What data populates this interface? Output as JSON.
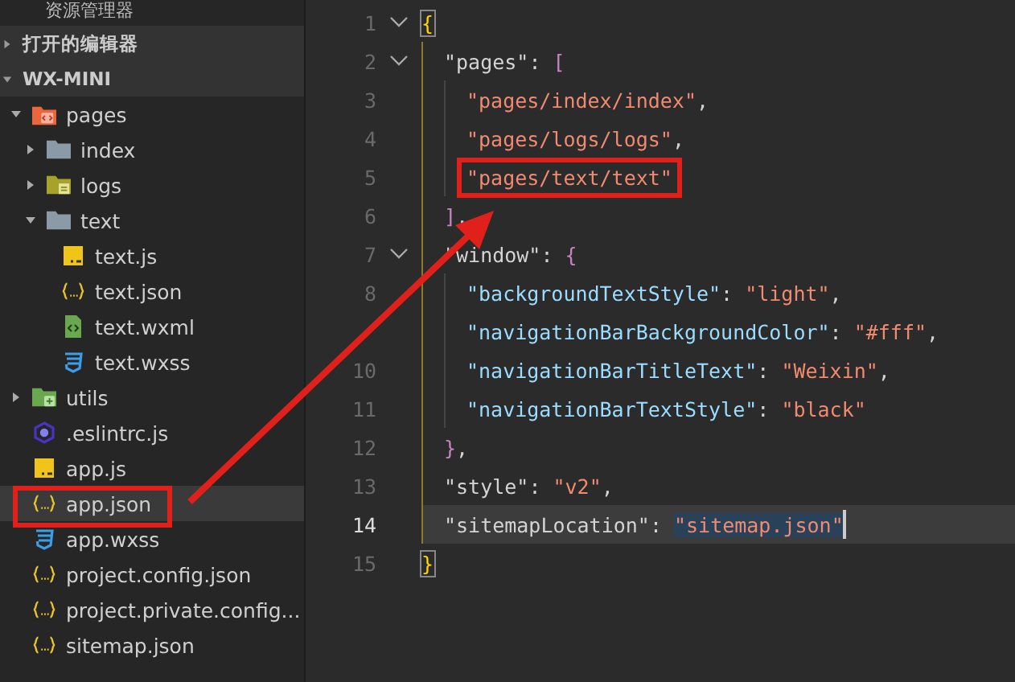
{
  "sidebar": {
    "title": "资源管理器",
    "sections": [
      {
        "label": "打开的编辑器",
        "expanded": false
      },
      {
        "label": "WX-MINI",
        "expanded": true
      }
    ],
    "tree": [
      {
        "label": "pages",
        "kind": "folder-pages",
        "expanded": true,
        "selected": false,
        "boxed": false,
        "children": [
          {
            "label": "index",
            "kind": "folder",
            "expanded": false,
            "selected": false,
            "boxed": false
          },
          {
            "label": "logs",
            "kind": "folder-logs",
            "expanded": false,
            "selected": false,
            "boxed": false
          },
          {
            "label": "text",
            "kind": "folder",
            "expanded": true,
            "selected": false,
            "boxed": false,
            "children": [
              {
                "label": "text.js",
                "kind": "js",
                "selected": false,
                "boxed": false
              },
              {
                "label": "text.json",
                "kind": "json",
                "selected": false,
                "boxed": false
              },
              {
                "label": "text.wxml",
                "kind": "wxml",
                "selected": false,
                "boxed": false
              },
              {
                "label": "text.wxss",
                "kind": "wxss",
                "selected": false,
                "boxed": false
              }
            ]
          }
        ]
      },
      {
        "label": "utils",
        "kind": "folder-utils",
        "expanded": false,
        "selected": false,
        "boxed": false
      },
      {
        "label": ".eslintrc.js",
        "kind": "eslint",
        "selected": false,
        "boxed": false
      },
      {
        "label": "app.js",
        "kind": "js",
        "selected": false,
        "boxed": false
      },
      {
        "label": "app.json",
        "kind": "json",
        "selected": true,
        "boxed": true
      },
      {
        "label": "app.wxss",
        "kind": "wxss",
        "selected": false,
        "boxed": false
      },
      {
        "label": "project.config.json",
        "kind": "json",
        "selected": false,
        "boxed": false
      },
      {
        "label": "project.private.config...",
        "kind": "json",
        "selected": false,
        "boxed": false
      },
      {
        "label": "sitemap.json",
        "kind": "json",
        "selected": false,
        "boxed": false
      }
    ]
  },
  "editor": {
    "lines": [
      {
        "number": "1",
        "foldable": true,
        "current": false,
        "boxed": false,
        "tokens": [
          {
            "kind": "brace-matched",
            "text": "{"
          }
        ],
        "children": [
          {
            "number": "2",
            "foldable": true,
            "current": false,
            "boxed": false,
            "tokens": [
              {
                "kind": "property",
                "text": "\"pages\""
              },
              {
                "kind": "punct",
                "text": ": "
              },
              {
                "kind": "bracket",
                "text": "["
              }
            ],
            "children": [
              {
                "number": "3",
                "foldable": false,
                "current": false,
                "boxed": false,
                "tokens": [
                  {
                    "kind": "string",
                    "text": "\"pages/index/index\""
                  },
                  {
                    "kind": "punct",
                    "text": ","
                  }
                ]
              },
              {
                "number": "4",
                "foldable": false,
                "current": false,
                "boxed": false,
                "tokens": [
                  {
                    "kind": "string",
                    "text": "\"pages/logs/logs\""
                  },
                  {
                    "kind": "punct",
                    "text": ","
                  }
                ]
              },
              {
                "number": "5",
                "foldable": false,
                "current": false,
                "boxed": true,
                "tokens": [
                  {
                    "kind": "string",
                    "text": "\"pages/text/text\""
                  }
                ]
              }
            ]
          },
          {
            "number": "6",
            "foldable": false,
            "current": false,
            "boxed": false,
            "tokens": [
              {
                "kind": "bracket",
                "text": "]"
              },
              {
                "kind": "punct",
                "text": ","
              }
            ]
          },
          {
            "number": "7",
            "foldable": true,
            "current": false,
            "boxed": false,
            "tokens": [
              {
                "kind": "property",
                "text": "\"window\""
              },
              {
                "kind": "punct",
                "text": ": "
              },
              {
                "kind": "bracket",
                "text": "{"
              }
            ],
            "children": [
              {
                "number": "8",
                "foldable": false,
                "current": false,
                "boxed": false,
                "tokens": [
                  {
                    "kind": "nested-property",
                    "text": "\"backgroundTextStyle\""
                  },
                  {
                    "kind": "punct",
                    "text": ": "
                  },
                  {
                    "kind": "string",
                    "text": "\"light\""
                  },
                  {
                    "kind": "punct",
                    "text": ","
                  }
                ]
              },
              {
                "foldable": false,
                "current": false,
                "boxed": false,
                "tokens": [
                  {
                    "kind": "nested-property",
                    "text": "\"navigationBarBackgroundColor\""
                  },
                  {
                    "kind": "punct",
                    "text": ": "
                  },
                  {
                    "kind": "string",
                    "text": "\"#fff\""
                  },
                  {
                    "kind": "punct",
                    "text": ","
                  }
                ]
              },
              {
                "number": "10",
                "foldable": false,
                "current": false,
                "boxed": false,
                "tokens": [
                  {
                    "kind": "nested-property",
                    "text": "\"navigationBarTitleText\""
                  },
                  {
                    "kind": "punct",
                    "text": ": "
                  },
                  {
                    "kind": "string",
                    "text": "\"Weixin\""
                  },
                  {
                    "kind": "punct",
                    "text": ","
                  }
                ]
              },
              {
                "number": "11",
                "foldable": false,
                "current": false,
                "boxed": false,
                "tokens": [
                  {
                    "kind": "nested-property",
                    "text": "\"navigationBarTextStyle\""
                  },
                  {
                    "kind": "punct",
                    "text": ": "
                  },
                  {
                    "kind": "string",
                    "text": "\"black\""
                  }
                ]
              }
            ]
          },
          {
            "number": "12",
            "foldable": false,
            "current": false,
            "boxed": false,
            "tokens": [
              {
                "kind": "bracket",
                "text": "}"
              },
              {
                "kind": "punct",
                "text": ","
              }
            ]
          },
          {
            "number": "13",
            "foldable": false,
            "current": false,
            "boxed": false,
            "tokens": [
              {
                "kind": "property",
                "text": "\"style\""
              },
              {
                "kind": "punct",
                "text": ": "
              },
              {
                "kind": "string",
                "text": "\"v2\""
              },
              {
                "kind": "punct",
                "text": ","
              }
            ]
          },
          {
            "number": "14",
            "foldable": false,
            "current": true,
            "boxed": false,
            "tokens": [
              {
                "kind": "property",
                "text": "\"sitemapLocation\""
              },
              {
                "kind": "punct",
                "text": ": "
              },
              {
                "kind": "selected-string",
                "text": "\"sitemap.json\""
              }
            ]
          }
        ]
      },
      {
        "number": "15",
        "foldable": false,
        "current": false,
        "boxed": false,
        "tokens": [
          {
            "kind": "brace-matched",
            "text": "}"
          }
        ]
      }
    ]
  }
}
